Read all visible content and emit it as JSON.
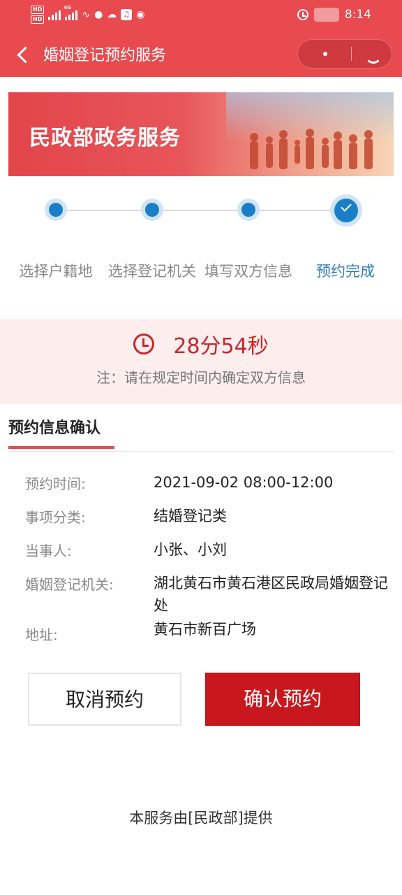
{
  "status_bar": {
    "hd1": "HD",
    "hd2": "HD",
    "signal_gen": "4G",
    "time": "8:14",
    "icons": [
      "hd-icon",
      "signal-icon",
      "signal-icon",
      "wifi-icon",
      "battery-saver-icon",
      "cloud-icon",
      "music-icon",
      "message-icon",
      "alarm-icon"
    ]
  },
  "titlebar": {
    "title": "婚姻登记预约服务"
  },
  "banner": {
    "title": "民政部政务服务"
  },
  "steps": [
    {
      "label": "选择户籍地",
      "state": "done"
    },
    {
      "label": "选择登记机关",
      "state": "done"
    },
    {
      "label": "填写双方信息",
      "state": "done"
    },
    {
      "label": "预约完成",
      "state": "current"
    }
  ],
  "countdown": {
    "time": "28分54秒",
    "note": "注：请在规定时间内确定双方信息"
  },
  "confirmation": {
    "title": "预约信息确认",
    "rows": [
      {
        "label": "预约时间:",
        "value": "2021-09-02 08:00-12:00"
      },
      {
        "label": "事项分类:",
        "value": "结婚登记类"
      },
      {
        "label": "当事人:",
        "value": "小张、小刘"
      },
      {
        "label": "婚姻登记机关:",
        "value": "湖北黄石市黄石港区民政局婚姻登记处"
      },
      {
        "label": "地址:",
        "value": "黄石市新百广场"
      }
    ]
  },
  "buttons": {
    "cancel": "取消预约",
    "confirm": "确认预约"
  },
  "footer": "本服务由[民政部]提供",
  "colors": {
    "header_red": "#e84a4f",
    "confirm_red": "#c8181e",
    "step_blue": "#1a7fc6",
    "timer_red": "#c8262c"
  }
}
